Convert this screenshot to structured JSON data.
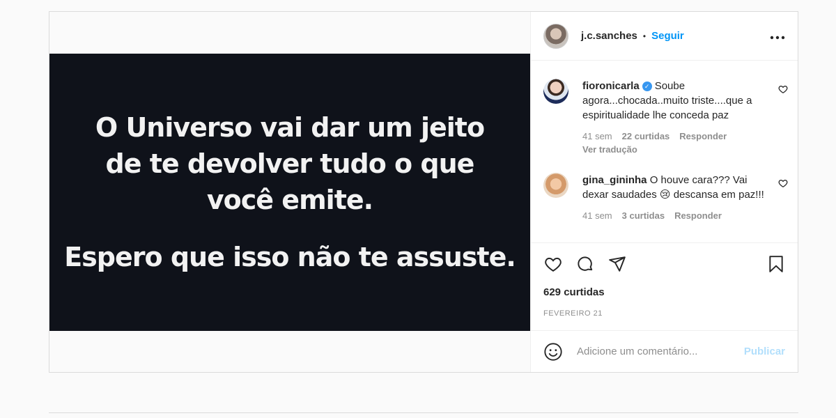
{
  "post": {
    "image_text": {
      "line1": "O Universo vai dar um jeito",
      "line2": "de te devolver tudo o que",
      "line3": "você emite.",
      "line4": "Espero que isso não te assuste."
    },
    "author": {
      "username": "j.c.sanches",
      "separator": "•",
      "follow_label": "Seguir",
      "more_icon": "more-horizontal-icon"
    },
    "comments": [
      {
        "username": "fioronicarla",
        "verified": true,
        "text": "Soube agora...chocada..muito triste....que a espiritualidade lhe conceda paz",
        "time": "41 sem",
        "likes": "22 curtidas",
        "reply_label": "Responder",
        "translation_label": "Ver tradução"
      },
      {
        "username": "gina_gininha",
        "verified": false,
        "text": "O houve cara??? Vai dexar saudades 😢 descansa em paz!!!",
        "time": "41 sem",
        "likes": "3 curtidas",
        "reply_label": "Responder"
      }
    ],
    "likes_count": "629 curtidas",
    "date": "FEVEREIRO 21",
    "add_comment": {
      "placeholder": "Adicione um comentário...",
      "publish_label": "Publicar",
      "emoji_icon": "smiley-icon"
    },
    "colors": {
      "accent": "#0095f6",
      "publish_disabled": "#b2dffc",
      "image_background": "#0f121a",
      "muted_text": "#8e8e8e"
    }
  }
}
